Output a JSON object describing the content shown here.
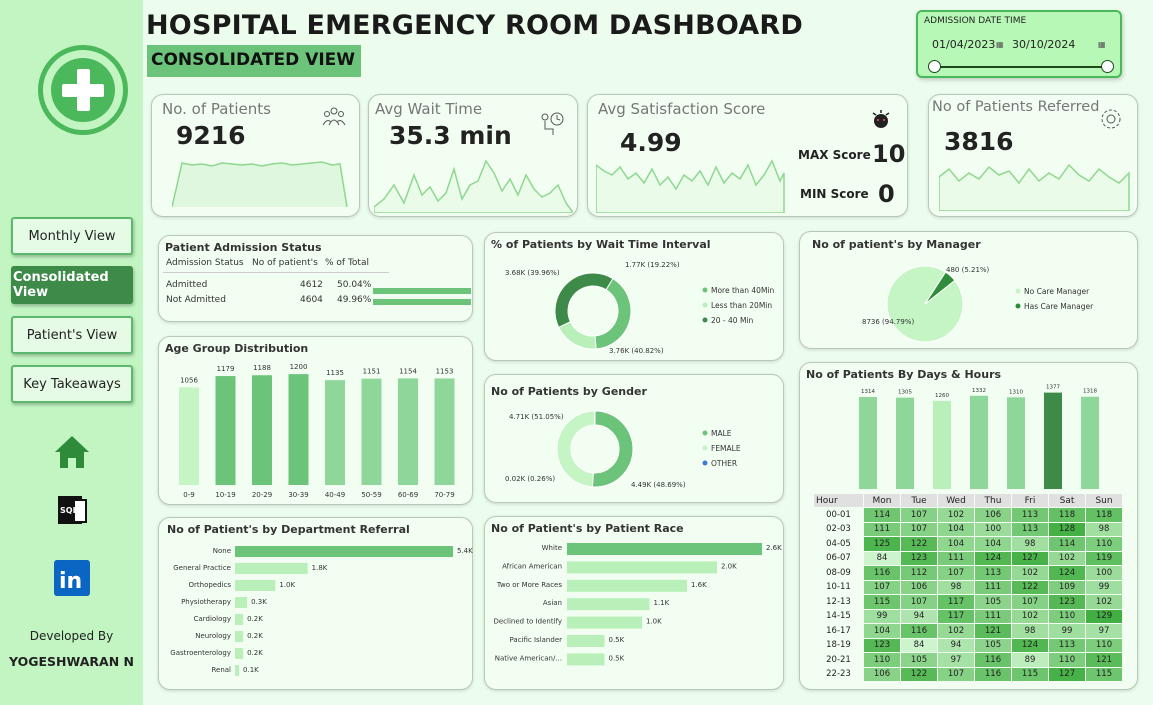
{
  "header": {
    "title": "HOSPITAL EMERGENCY ROOM DASHBOARD",
    "subtitle": "CONSOLIDATED VIEW"
  },
  "filter": {
    "label": "ADMISSION DATE TIME",
    "start": "01/04/2023",
    "end": "30/10/2024"
  },
  "nav": {
    "monthly": "Monthly View",
    "consolidated": "Consolidated View",
    "patients": "Patient's View",
    "takeaways": "Key Takeaways"
  },
  "sidebar_icons": [
    "home-icon",
    "sql-icon",
    "linkedin-icon"
  ],
  "developer": {
    "label": "Developed By",
    "name": "YOGESHWARAN N"
  },
  "colors": {
    "accent": "#4cb85c",
    "dark": "#3e8a48",
    "light": "#b9f0b9"
  },
  "kpis": {
    "patients": {
      "title": "No. of Patients",
      "value": "9216"
    },
    "wait": {
      "title": "Avg Wait Time",
      "value": "35.3 min"
    },
    "satisfaction": {
      "title": "Avg Satisfaction Score",
      "value": "4.99",
      "max_label": "MAX Score",
      "max": "10",
      "min_label": "MIN Score",
      "min": "0"
    },
    "referred": {
      "title": "No of Patients Referred",
      "value": "3816"
    }
  },
  "admission": {
    "title": "Patient Admission Status",
    "headers": [
      "Admission Status",
      "No of patient's",
      "% of Total"
    ],
    "rows": [
      {
        "status": "Admitted",
        "count": "4612",
        "pct": "50.04%",
        "fraction": 0.5004
      },
      {
        "status": "Not Admitted",
        "count": "4604",
        "pct": "49.96%",
        "fraction": 0.4996
      }
    ]
  },
  "chart_data": [
    {
      "type": "bar",
      "title": "Age Group Distribution",
      "categories": [
        "0-9",
        "10-19",
        "20-29",
        "30-39",
        "40-49",
        "50-59",
        "60-69",
        "70-79"
      ],
      "values": [
        1056,
        1179,
        1188,
        1200,
        1135,
        1151,
        1154,
        1153
      ],
      "ylim": [
        0,
        1250
      ]
    },
    {
      "type": "pie",
      "title": "% of Patients by Wait Time Interval",
      "labels": [
        "More than 40Min",
        "Less than 20Min",
        "20 - 40 Min"
      ],
      "values": [
        3.68,
        1.77,
        3.76
      ],
      "data_labels": [
        "3.68K (39.96%)",
        "1.77K (19.22%)",
        "3.76K (40.82%)"
      ],
      "colors": [
        "#6cc47a",
        "#b9f0b9",
        "#3e8a48"
      ]
    },
    {
      "type": "pie",
      "title": "No of patient's by Manager",
      "labels": [
        "No Care Manager",
        "Has Care Manager"
      ],
      "values": [
        8736,
        480
      ],
      "data_labels": [
        "8736 (94.79%)",
        "480 (5.21%)"
      ],
      "colors": [
        "#c5f5c5",
        "#2e8b3a"
      ]
    },
    {
      "type": "pie",
      "title": "No of Patients by Gender",
      "labels": [
        "MALE",
        "FEMALE",
        "OTHER"
      ],
      "values": [
        4.71,
        4.49,
        0.02
      ],
      "data_labels": [
        "4.71K (51.05%)",
        "4.49K (48.69%)",
        "0.02K (0.26%)"
      ],
      "colors": [
        "#6cc47a",
        "#c5f5c5",
        "#3a7bd5"
      ]
    },
    {
      "type": "bar",
      "title": "No of Patients By Days & Hours",
      "categories": [
        "Mon",
        "Tue",
        "Wed",
        "Thu",
        "Fri",
        "Sat",
        "Sun"
      ],
      "values": [
        1314,
        1305,
        1260,
        1332,
        1310,
        1377,
        1318
      ],
      "ylim": [
        0,
        1400
      ]
    },
    {
      "type": "bar",
      "orientation": "horizontal",
      "title": "No of Patient's by Department Referral",
      "categories": [
        "None",
        "General Practice",
        "Orthopedics",
        "Physiotherapy",
        "Cardiology",
        "Neurology",
        "Gastroenterology",
        "Renal"
      ],
      "values": [
        5.4,
        1.8,
        1.0,
        0.3,
        0.2,
        0.2,
        0.2,
        0.1
      ],
      "data_labels": [
        "5.4K",
        "1.8K",
        "1.0K",
        "0.3K",
        "0.2K",
        "0.2K",
        "0.2K",
        "0.1K"
      ]
    },
    {
      "type": "bar",
      "orientation": "horizontal",
      "title": "No of Patient's by Patient Race",
      "categories": [
        "White",
        "African American",
        "Two or More Races",
        "Asian",
        "Declined to Identify",
        "Pacific Islander",
        "Native American/..."
      ],
      "values": [
        2.6,
        2.0,
        1.6,
        1.1,
        1.0,
        0.5,
        0.5
      ],
      "data_labels": [
        "2.6K",
        "2.0K",
        "1.6K",
        "1.1K",
        "1.0K",
        "0.5K",
        "0.5K"
      ]
    },
    {
      "type": "heatmap",
      "title": "No of Patients By Days & Hours",
      "corner": "Hour",
      "x": [
        "Mon",
        "Tue",
        "Wed",
        "Thu",
        "Fri",
        "Sat",
        "Sun"
      ],
      "y": [
        "00-01",
        "02-03",
        "04-05",
        "06-07",
        "08-09",
        "10-11",
        "12-13",
        "14-15",
        "16-17",
        "18-19",
        "20-21",
        "22-23"
      ],
      "values": [
        [
          114,
          107,
          102,
          106,
          113,
          118,
          118
        ],
        [
          111,
          107,
          104,
          100,
          113,
          128,
          98
        ],
        [
          125,
          122,
          104,
          104,
          98,
          114,
          110
        ],
        [
          84,
          123,
          111,
          124,
          127,
          102,
          119
        ],
        [
          116,
          112,
          107,
          113,
          102,
          124,
          100
        ],
        [
          107,
          106,
          98,
          111,
          122,
          109,
          99
        ],
        [
          115,
          107,
          117,
          105,
          107,
          123,
          102
        ],
        [
          99,
          94,
          117,
          111,
          102,
          110,
          129
        ],
        [
          104,
          116,
          102,
          121,
          98,
          99,
          97
        ],
        [
          123,
          84,
          94,
          105,
          124,
          113,
          110
        ],
        [
          110,
          105,
          97,
          116,
          89,
          110,
          121
        ],
        [
          106,
          122,
          107,
          116,
          115,
          127,
          115
        ]
      ]
    }
  ]
}
